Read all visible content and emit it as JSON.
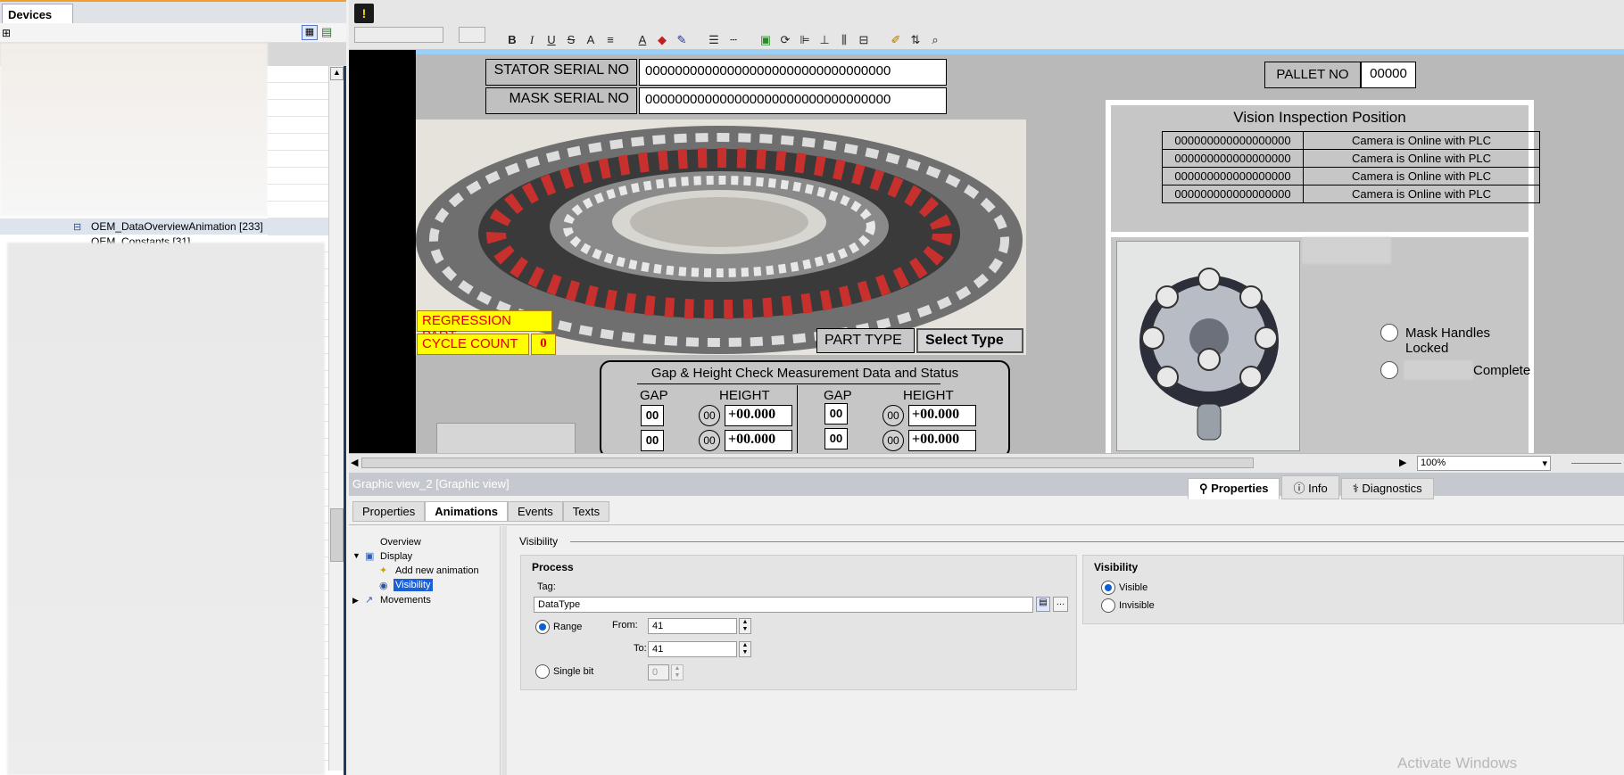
{
  "left_panel": {
    "tab": "Devices",
    "tree_item": "OEM_DataOverviewAnimation [233]",
    "tree_item_partial": "OEM_Constants [31]"
  },
  "canvas": {
    "stator_label": "STATOR SERIAL NO",
    "stator_value": "000000000000000000000000000000000",
    "mask_label": "MASK SERIAL NO",
    "mask_value": "000000000000000000000000000000000",
    "pallet_label": "PALLET NO",
    "pallet_value": "00000",
    "vision_title": "Vision Inspection Position",
    "vision_rows": [
      {
        "id": "000000000000000000",
        "status": "Camera is Online with PLC"
      },
      {
        "id": "000000000000000000",
        "status": "Camera is Online with PLC"
      },
      {
        "id": "000000000000000000",
        "status": "Camera is Online with PLC"
      },
      {
        "id": "000000000000000000",
        "status": "Camera is Online with PLC"
      }
    ],
    "regression": "REGRESSION PART",
    "cycle_label": "CYCLE COUNT",
    "cycle_value": "0",
    "part_type_label": "PART TYPE",
    "select_type": "Select Type",
    "gap_title": "Gap & Height Check Measurement Data and Status",
    "gap_hdr": "GAP",
    "height_hdr": "HEIGHT",
    "gap_val": "00",
    "circle_val": "00",
    "height_val": "+00.000",
    "mask_handles": "Mask Handles Locked",
    "complete": "Complete"
  },
  "zoom": "100%",
  "inspector": {
    "title": "Graphic view_2 [Graphic view]",
    "right_tabs": [
      "Properties",
      "Info",
      "Diagnostics"
    ],
    "tabs": [
      "Properties",
      "Animations",
      "Events",
      "Texts"
    ],
    "tree": {
      "overview": "Overview",
      "display": "Display",
      "add": "Add new animation",
      "visibility": "Visibility",
      "movements": "Movements"
    },
    "section": "Visibility",
    "process": {
      "title": "Process",
      "tag_label": "Tag:",
      "tag_value": "DataType",
      "range": "Range",
      "from_label": "From:",
      "from": "41",
      "to_label": "To:",
      "to": "41",
      "single_bit": "Single bit",
      "bit": "0"
    },
    "visibility": {
      "title": "Visibility",
      "visible": "Visible",
      "invisible": "Invisible"
    }
  },
  "watermark": "Activate Windows"
}
